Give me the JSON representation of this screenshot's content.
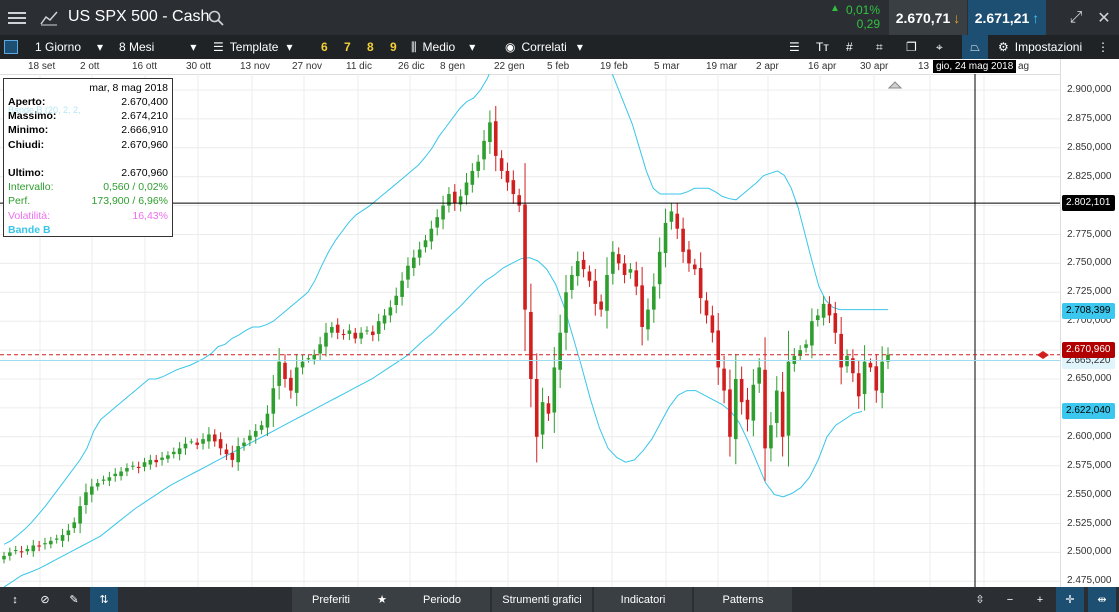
{
  "header": {
    "title": "US SPX 500 - Cash",
    "change_pct": "0,01%",
    "change_abs": "0,29",
    "sell_price": "2.670,71",
    "buy_price": "2.671,21"
  },
  "toolbar": {
    "period": "1 Giorno",
    "range": "8 Mesi",
    "template": "Template",
    "template_nums": [
      "6",
      "7",
      "8",
      "9"
    ],
    "medio": "Medio",
    "correlati": "Correlati",
    "impostazioni": "Impostazioni",
    "text_tool": "Tᴛ"
  },
  "date_axis": [
    "18 set",
    "2 ott",
    "16 ott",
    "30 ott",
    "13 nov",
    "27 nov",
    "11 dic",
    "26 dic",
    "8 gen",
    "22 gen",
    "5 feb",
    "19 feb",
    "5 mar",
    "19 mar",
    "2 apr",
    "16 apr",
    "30 apr",
    "13"
  ],
  "crosshair": {
    "date_label": "gio, 24 mag 2018",
    "date_trail": "ag",
    "price_label": "2.802,101"
  },
  "price_tags": {
    "upper": "2.708,399",
    "last": "2.670,960",
    "lower": "2.622,040",
    "middle_hidden": "2.665,220"
  },
  "colors": {
    "up": "#2e9e2e",
    "down": "#d11f1f",
    "band": "#38c6e8",
    "last_line": "#d11f1f",
    "tag_band": "#3cc8ee",
    "tag_last": "#b00000"
  },
  "info_panel": {
    "date": "mar, 8 mag 2018",
    "overlay_text": "Bande B (20, 2, 2,",
    "rows": [
      {
        "k": "Aperto:",
        "v": "2.670,400",
        "c": "#000"
      },
      {
        "k": "Massimo:",
        "v": "2.674,210",
        "c": "#000"
      },
      {
        "k": "Minimo:",
        "v": "2.666,910",
        "c": "#000"
      },
      {
        "k": "Chiudi:",
        "v": "2.670,960",
        "c": "#000"
      },
      {
        "k": "",
        "v": "",
        "c": "#000"
      },
      {
        "k": "Ultimo:",
        "v": "2.670,960",
        "c": "#000"
      },
      {
        "k": "Intervallo:",
        "v": "0,560 / 0,02%",
        "c": "#2e9e2e"
      },
      {
        "k": "Perf.",
        "v": "173,900 / 6,96%",
        "c": "#2e9e2e"
      },
      {
        "k": "Volatilità:",
        "v": "16,43%",
        "c": "#f06ef0"
      },
      {
        "k": "Bande B",
        "v": "",
        "c": "#38c6e8"
      }
    ]
  },
  "bottom": {
    "preferiti": "Preferiti",
    "periodo": "Periodo",
    "strumenti": "Strumenti grafici",
    "indicatori": "Indicatori",
    "patterns": "Patterns"
  },
  "chart_data": {
    "type": "candlestick",
    "ylim": [
      2462,
      2912
    ],
    "y_ticks": [
      "2.900,000",
      "2.875,000",
      "2.850,000",
      "2.825,000",
      "2.800,000",
      "2.775,000",
      "2.750,000",
      "2.725,000",
      "2.700,000",
      "2.675,000",
      "2.650,000",
      "2.625,000",
      "2.600,000",
      "2.575,000",
      "2.550,000",
      "2.525,000",
      "2.500,000",
      "2.475,000"
    ],
    "last_price": 2670.96,
    "crosshair_price": 2802.101,
    "closes": [
      2497,
      2500,
      2502,
      2500,
      2503,
      2506,
      2505,
      2508,
      2510,
      2512,
      2515,
      2519,
      2526,
      2540,
      2552,
      2557,
      2560,
      2563,
      2565,
      2568,
      2570,
      2573,
      2575,
      2573,
      2578,
      2580,
      2578,
      2582,
      2584,
      2587,
      2590,
      2594,
      2596,
      2593,
      2598,
      2602,
      2596,
      2590,
      2585,
      2580,
      2592,
      2595,
      2601,
      2605,
      2610,
      2620,
      2642,
      2665,
      2650,
      2640,
      2660,
      2665,
      2668,
      2671,
      2680,
      2690,
      2695,
      2690,
      2688,
      2692,
      2685,
      2690,
      2692,
      2688,
      2700,
      2705,
      2712,
      2722,
      2735,
      2748,
      2755,
      2762,
      2770,
      2780,
      2790,
      2800,
      2810,
      2802,
      2808,
      2820,
      2830,
      2838,
      2856,
      2872,
      2843,
      2830,
      2820,
      2810,
      2800,
      2710,
      2650,
      2600,
      2630,
      2620,
      2660,
      2690,
      2725,
      2740,
      2752,
      2745,
      2735,
      2715,
      2710,
      2740,
      2760,
      2750,
      2740,
      2745,
      2730,
      2695,
      2710,
      2730,
      2760,
      2785,
      2795,
      2780,
      2760,
      2750,
      2745,
      2720,
      2705,
      2690,
      2660,
      2640,
      2600,
      2650,
      2630,
      2615,
      2645,
      2660,
      2590,
      2610,
      2640,
      2600,
      2665,
      2670,
      2675,
      2680,
      2700,
      2705,
      2715,
      2705,
      2690,
      2660,
      2670,
      2655,
      2635,
      2665,
      2660,
      2640,
      2665,
      2671
    ],
    "bands": {
      "upper": [
        2507,
        2510,
        2515,
        2520,
        2526,
        2533,
        2540,
        2548,
        2556,
        2564,
        2572,
        2580,
        2590,
        2605,
        2615,
        2620,
        2625,
        2630,
        2635,
        2640,
        2645,
        2650,
        2650,
        2652,
        2655,
        2658,
        2660,
        2662,
        2665,
        2668,
        2672,
        2678,
        2680,
        2685,
        2688,
        2692,
        2695,
        2695,
        2697,
        2700,
        2705,
        2710,
        2715,
        2720,
        2725,
        2735,
        2748,
        2760,
        2770,
        2778,
        2786,
        2792,
        2796,
        2800,
        2805,
        2810,
        2815,
        2820,
        2825,
        2830,
        2835,
        2842,
        2850,
        2860,
        2868,
        2876,
        2884,
        2890,
        2893,
        2900,
        2910,
        2925,
        2935,
        2945,
        2955,
        2960,
        2962,
        2965,
        2968,
        2968,
        2968,
        2966,
        2964,
        2962,
        2958,
        2955,
        2945,
        2930,
        2915,
        2900,
        2885,
        2870,
        2850,
        2830,
        2815,
        2810,
        2810,
        2810,
        2810,
        2812,
        2815,
        2815,
        2815,
        2812,
        2808,
        2806,
        2805,
        2810,
        2815,
        2820,
        2826,
        2828,
        2830,
        2826,
        2815,
        2798,
        2775,
        2752,
        2730,
        2718,
        2712,
        2710,
        2710,
        2710,
        2710,
        2710,
        2710,
        2710,
        2710
      ],
      "lower": [
        2470,
        2475,
        2480,
        2483,
        2486,
        2490,
        2494,
        2498,
        2502,
        2506,
        2510,
        2514,
        2520,
        2526,
        2532,
        2538,
        2543,
        2548,
        2553,
        2558,
        2562,
        2566,
        2570,
        2574,
        2578,
        2582,
        2586,
        2590,
        2594,
        2598,
        2602,
        2606,
        2610,
        2614,
        2618,
        2622,
        2626,
        2630,
        2634,
        2638,
        2642,
        2646,
        2650,
        2655,
        2660,
        2665,
        2670,
        2677,
        2684,
        2690,
        2698,
        2705,
        2712,
        2720,
        2728,
        2735,
        2740,
        2746,
        2750,
        2754,
        2755,
        2752,
        2745,
        2732,
        2712,
        2686,
        2660,
        2632,
        2608,
        2590,
        2582,
        2578,
        2580,
        2588,
        2598,
        2612,
        2626,
        2636,
        2640,
        2640,
        2636,
        2632,
        2628,
        2622,
        2612,
        2596,
        2578,
        2560,
        2550,
        2548,
        2551,
        2556,
        2565,
        2580,
        2600,
        2610,
        2615,
        2620,
        2622
      ]
    }
  }
}
